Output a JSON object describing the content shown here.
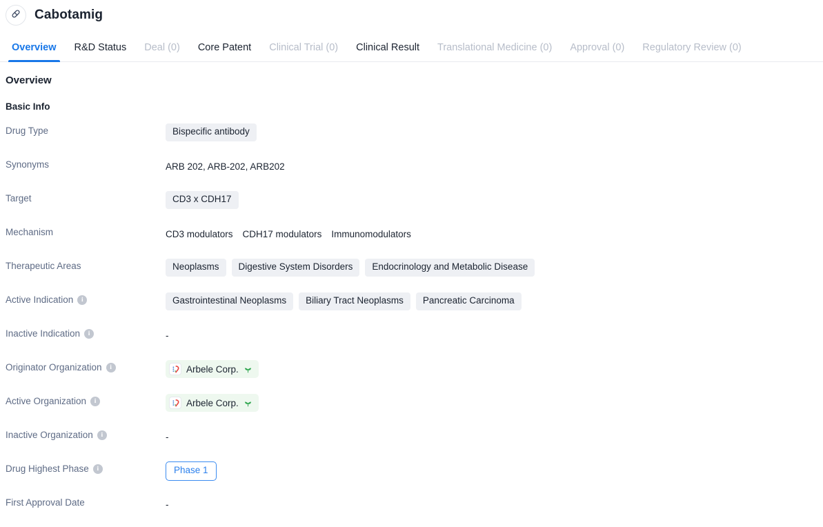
{
  "header": {
    "drug_name": "Cabotamig",
    "avatar_icon": "pill-capsule-icon"
  },
  "tabs": [
    {
      "label": "Overview",
      "state": "active"
    },
    {
      "label": "R&D Status",
      "state": "normal"
    },
    {
      "label": "Deal (0)",
      "state": "disabled"
    },
    {
      "label": "Core Patent",
      "state": "normal"
    },
    {
      "label": "Clinical Trial (0)",
      "state": "disabled"
    },
    {
      "label": "Clinical Result",
      "state": "normal"
    },
    {
      "label": "Translational Medicine (0)",
      "state": "disabled"
    },
    {
      "label": "Approval (0)",
      "state": "disabled"
    },
    {
      "label": "Regulatory Review (0)",
      "state": "disabled"
    }
  ],
  "overview": {
    "section_title": "Overview",
    "subsection_title": "Basic Info",
    "info_icon_glyph": "i",
    "empty_placeholder": "-",
    "rows": {
      "drug_type": {
        "label": "Drug Type",
        "tags": [
          "Bispecific antibody"
        ]
      },
      "synonyms": {
        "label": "Synonyms",
        "value": "ARB 202,  ARB-202,  ARB202"
      },
      "target": {
        "label": "Target",
        "tags": [
          "CD3 x CDH17"
        ]
      },
      "mechanism": {
        "label": "Mechanism",
        "items": [
          "CD3 modulators",
          "CDH17 modulators",
          "Immunomodulators"
        ]
      },
      "therapeutic_areas": {
        "label": "Therapeutic Areas",
        "tags": [
          "Neoplasms",
          "Digestive System Disorders",
          "Endocrinology and Metabolic Disease"
        ]
      },
      "active_indication": {
        "label": "Active Indication",
        "has_info": true,
        "tags": [
          "Gastrointestinal Neoplasms",
          "Biliary Tract Neoplasms",
          "Pancreatic Carcinoma"
        ]
      },
      "inactive_indication": {
        "label": "Inactive Indication",
        "has_info": true,
        "value": "-"
      },
      "originator_organization": {
        "label": "Originator Organization",
        "has_info": true,
        "org_name": "Arbele Corp.",
        "org_logo_icon": "arbele-logo-icon",
        "status_icon": "green-sprout-icon"
      },
      "active_organization": {
        "label": "Active Organization",
        "has_info": true,
        "org_name": "Arbele Corp.",
        "org_logo_icon": "arbele-logo-icon",
        "status_icon": "green-sprout-icon"
      },
      "inactive_organization": {
        "label": "Inactive Organization",
        "has_info": true,
        "value": "-"
      },
      "drug_highest_phase": {
        "label": "Drug Highest Phase",
        "has_info": true,
        "badge": "Phase 1"
      },
      "first_approval_date": {
        "label": "First Approval Date",
        "value": "-"
      }
    }
  },
  "colors": {
    "accent_blue": "#1877e8",
    "tag_bg": "#eef0f4",
    "org_chip_bg": "#eef8ef",
    "label_text": "#5e6b85",
    "body_text": "#1b2330",
    "disabled_tab": "#b7bdc9",
    "sprout_green": "#34a853"
  }
}
